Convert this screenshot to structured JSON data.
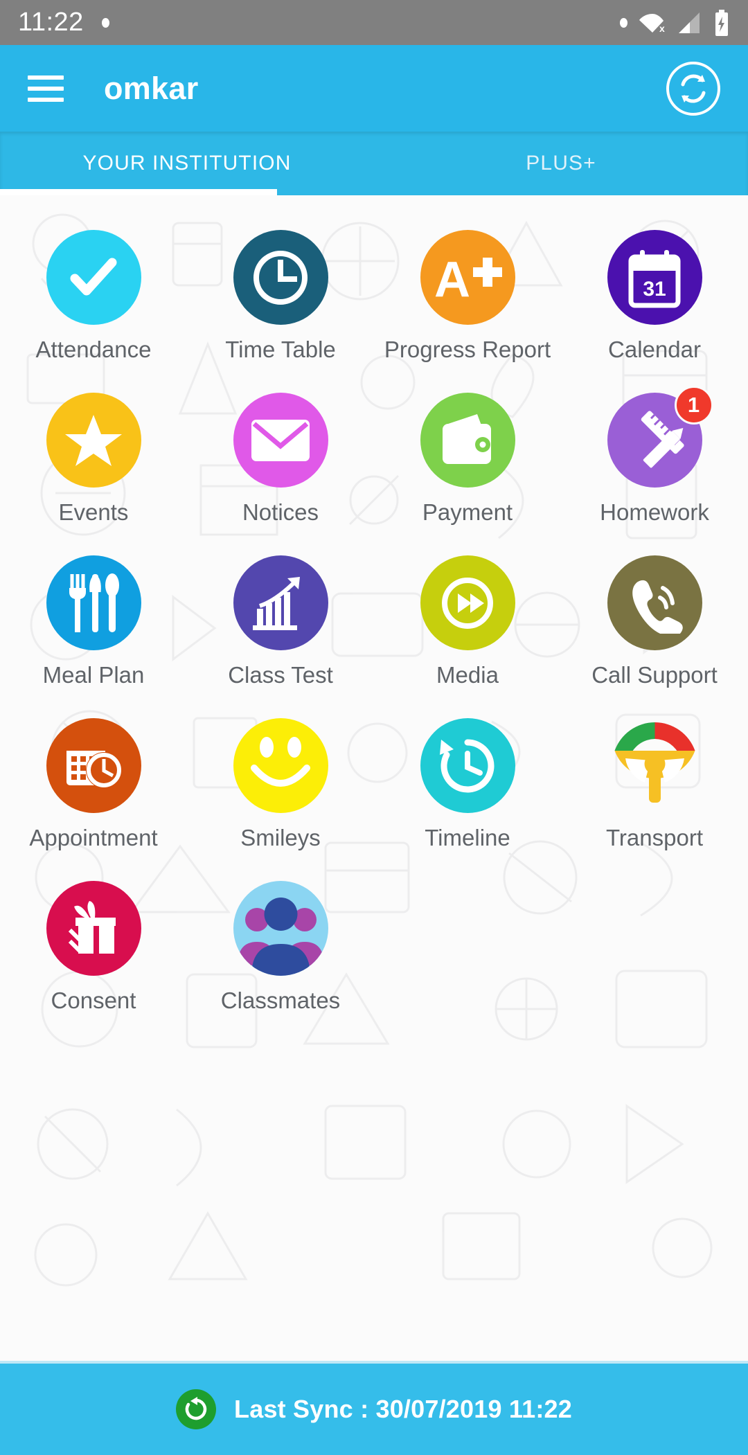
{
  "status_bar": {
    "clock": "11:22",
    "icons": [
      "notification-dot",
      "status-dot",
      "wifi-off-icon",
      "signal-icon",
      "battery-charging-icon"
    ]
  },
  "app_bar": {
    "menu_icon": "hamburger-menu-icon",
    "title": "omkar",
    "sync_icon": "sync-refresh-icon",
    "background_color": "#29b6e8"
  },
  "tabs": {
    "active_index": 0,
    "items": [
      {
        "label": "YOUR INSTITUTION"
      },
      {
        "label": "PLUS+"
      }
    ]
  },
  "grid": {
    "items": [
      {
        "label": "Attendance",
        "icon": "check-mark-icon",
        "color": "#2ad2f2",
        "badge": null
      },
      {
        "label": "Time Table",
        "icon": "clock-icon",
        "color": "#1a5f7a",
        "badge": null
      },
      {
        "label": "Progress\nReport",
        "icon": "a-plus-grade-icon",
        "color": "#f5991f",
        "badge": null
      },
      {
        "label": "Calendar",
        "icon": "calendar-31-icon",
        "color": "#4b11ae",
        "badge": null
      },
      {
        "label": "Events",
        "icon": "star-icon",
        "color": "#f9c218",
        "badge": null
      },
      {
        "label": "Notices",
        "icon": "envelope-icon",
        "color": "#e059e8",
        "badge": null
      },
      {
        "label": "Payment",
        "icon": "wallet-icon",
        "color": "#7ed14b",
        "badge": null
      },
      {
        "label": "Homework",
        "icon": "ruler-pencil-icon",
        "color": "#9a5fd6",
        "badge": "1"
      },
      {
        "label": "Meal Plan",
        "icon": "cutlery-icon",
        "color": "#109fe0",
        "badge": null
      },
      {
        "label": "Class Test",
        "icon": "bar-chart-arrow-icon",
        "color": "#5347ae",
        "badge": null
      },
      {
        "label": "Media",
        "icon": "play-fast-forward-icon",
        "color": "#c6cf0d",
        "badge": null
      },
      {
        "label": "Call Support",
        "icon": "phone-call-icon",
        "color": "#7a7342",
        "badge": null
      },
      {
        "label": "Appointment",
        "icon": "calendar-clock-icon",
        "color": "#d4500d",
        "badge": null
      },
      {
        "label": "Smileys",
        "icon": "smiley-face-icon",
        "color": "#fcee07",
        "badge": null
      },
      {
        "label": "Timeline",
        "icon": "clock-history-icon",
        "color": "#1fcbd4",
        "badge": null
      },
      {
        "label": "Transport",
        "icon": "steering-wheel-icon",
        "color": "#f6c024",
        "badge": null
      },
      {
        "label": "Consent",
        "icon": "gift-box-icon",
        "color": "#d80e4e",
        "badge": null
      },
      {
        "label": "Classmates",
        "icon": "people-group-icon",
        "color": "#8bd5f2",
        "badge": null
      }
    ]
  },
  "sync_bar": {
    "icon": "sync-refresh-icon",
    "text": "Last Sync : 30/07/2019 11:22",
    "background_color": "#35bdea"
  }
}
